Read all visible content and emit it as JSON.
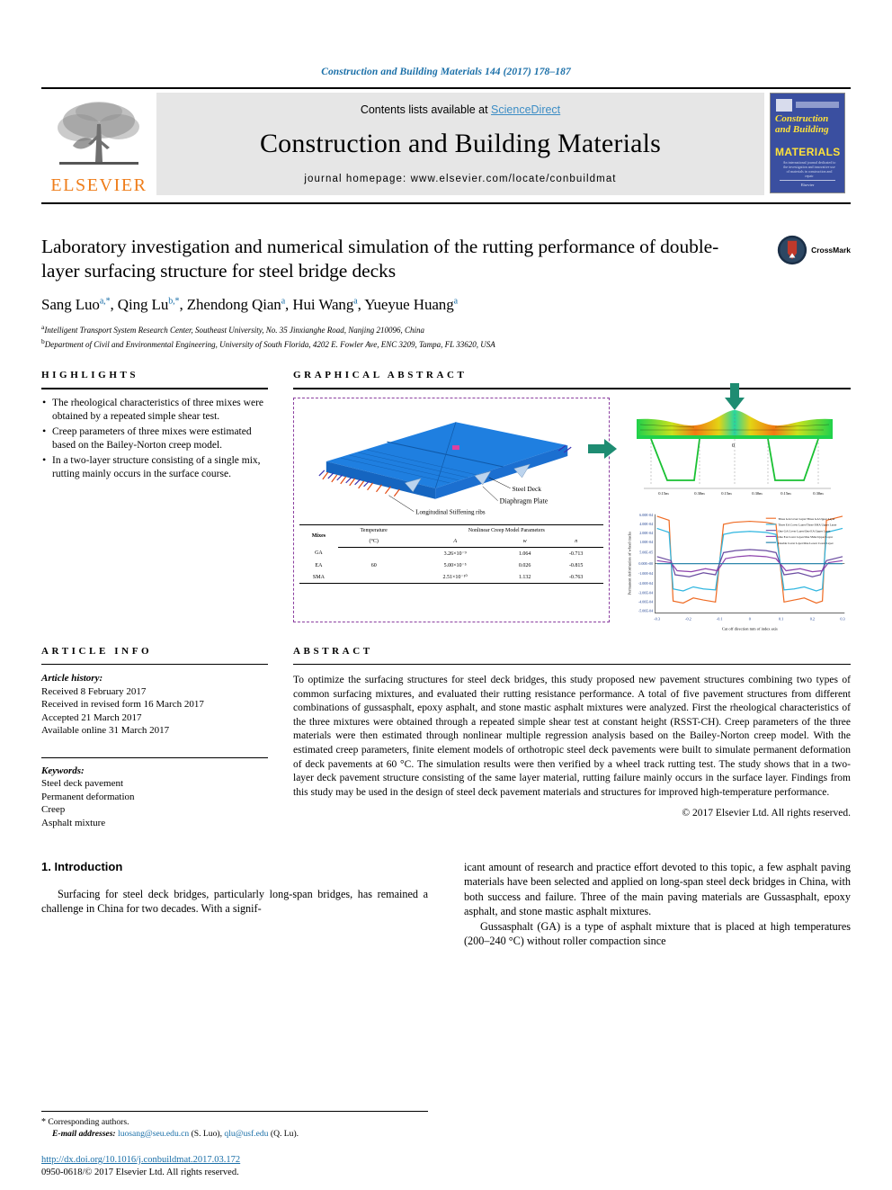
{
  "running_head": "Construction and Building Materials 144 (2017) 178–187",
  "banner": {
    "publisher_logo_text": "ELSEVIER",
    "contents_prefix": "Contents lists available at ",
    "contents_link": "ScienceDirect",
    "journal_name": "Construction and Building Materials",
    "homepage": "journal homepage: www.elsevier.com/locate/conbuildmat",
    "cover": {
      "title_line1": "Construction",
      "title_line2": "and Building",
      "materials": "MATERIALS",
      "subtitle": "An international journal dedicated to the investigation and innovative use of materials in construction and repair",
      "footer": "Elsevier"
    }
  },
  "article": {
    "title": "Laboratory investigation and numerical simulation of the rutting performance of double-layer surfacing structure for steel bridge decks",
    "crossmark_label": "CrossMark",
    "authors": [
      {
        "name": "Sang Luo",
        "sup": "a,*"
      },
      {
        "name": "Qing Lu",
        "sup": "b,*"
      },
      {
        "name": "Zhendong Qian",
        "sup": "a"
      },
      {
        "name": "Hui Wang",
        "sup": "a"
      },
      {
        "name": "Yueyue Huang",
        "sup": "a"
      }
    ],
    "affiliations": [
      {
        "mark": "a",
        "text": "Intelligent Transport System Research Center, Southeast University, No. 35 Jinxianghe Road, Nanjing 210096, China"
      },
      {
        "mark": "b",
        "text": "Department of Civil and Environmental Engineering, University of South Florida, 4202 E. Fowler Ave, ENC 3209, Tampa, FL 33620, USA"
      }
    ]
  },
  "highlights": {
    "heading": "HIGHLIGHTS",
    "items": [
      "The rheological characteristics of three mixes were obtained by a repeated simple shear test.",
      "Creep parameters of three mixes were estimated based on the Bailey-Norton creep model.",
      "In a two-layer structure consisting of a single mix, rutting mainly occurs in the surface course."
    ]
  },
  "graphical_abstract": {
    "heading": "GRAPHICAL ABSTRACT",
    "model_labels": {
      "steel_deck": "Steel Deck",
      "diaphragm_plate": "Diaphragm Plate",
      "stiffening_ribs": "Longitudinal Stiffening ribs"
    },
    "table": {
      "col_mixes": "Mixes",
      "col_temperature": "Temperature",
      "col_temperature_unit": "(°C)",
      "col_group": "Nonlinear Creep Model Parameters",
      "sub_cols": [
        "A",
        "w",
        "n"
      ],
      "rows": [
        {
          "mix": "GA",
          "temp": "",
          "A": "3.26×10⁻⁹",
          "w": "1.064",
          "n": "-0.713"
        },
        {
          "mix": "EA",
          "temp": "60",
          "A": "5.00×10⁻⁵",
          "w": "0.026",
          "n": "-0.815"
        },
        {
          "mix": "SMA",
          "temp": "",
          "A": "2.51×10⁻¹⁰",
          "w": "1.132",
          "n": "-0.763"
        }
      ]
    },
    "deformation_plot": {
      "x_ticks": [
        "0.15m",
        "0.30m",
        "0.15m",
        "0.30m",
        "0.15m",
        "0.30m"
      ],
      "center_label": "0"
    },
    "chart_data": {
      "type": "line",
      "title": "",
      "xlabel": "Cut off direction mm of index axis",
      "ylabel": "Permanent deformation  of wheel tracks",
      "x": [
        -0.3,
        -0.2,
        -0.1,
        0.0,
        0.1,
        0.2,
        0.3
      ],
      "x_ticks": [
        "-0.3",
        "-0.2",
        "-0.1",
        "0",
        "0.1",
        "0.2",
        "0.3"
      ],
      "y_ticks": [
        "6.00E-04",
        "4.00E-04",
        "2.00E-04",
        "1.00E-04",
        "5.00E-05",
        "0.00E+00",
        "-1.00E-04",
        "-2.00E-04",
        "-3.00E-04",
        "-4.00E-04",
        "-5.00E-04"
      ],
      "ylim": [
        -0.0005,
        0.0006
      ],
      "legend_position": "top-right",
      "series": [
        {
          "name": "Three GA Cover Layer/Three GA Upper Layer",
          "color": "#ef6c25",
          "values": [
            0.00055,
            -0.00042,
            -0.00038,
            0.00048,
            -0.00038,
            -0.00042,
            0.00055
          ]
        },
        {
          "name": "Three EA Cover Layer/Three SMA Upper Layer",
          "color": "#2fb6e0",
          "values": [
            0.0003,
            -0.00024,
            -0.00021,
            0.0003,
            -0.00021,
            -0.00024,
            0.0003
          ]
        },
        {
          "name": "One GA Cover Layer/One EA Upper Layer",
          "color": "#6a4ca0",
          "values": [
            8e-05,
            -9e-05,
            -7e-05,
            0.00012,
            -7e-05,
            -9e-05,
            8e-05
          ]
        },
        {
          "name": "One EA Cover Layer/One SMA Upper Layer",
          "color": "#8e44ad",
          "values": [
            5e-05,
            -6e-05,
            -5e-05,
            9e-05,
            -5e-05,
            -6e-05,
            5e-05
          ]
        },
        {
          "name": "Double Cover Layer/One Lower Cover Layer",
          "color": "#1a7fa8",
          "values": [
            0.0,
            0.0,
            0.0,
            0.0,
            0.0,
            0.0,
            0.0
          ]
        }
      ]
    }
  },
  "article_info": {
    "heading": "ARTICLE INFO",
    "history_label": "Article history:",
    "history": [
      "Received 8 February 2017",
      "Received in revised form 16 March 2017",
      "Accepted 21 March 2017",
      "Available online 31 March 2017"
    ],
    "keywords_label": "Keywords:",
    "keywords": [
      "Steel deck pavement",
      "Permanent deformation",
      "Creep",
      "Asphalt mixture"
    ]
  },
  "abstract": {
    "heading": "ABSTRACT",
    "text": "To optimize the surfacing structures for steel deck bridges, this study proposed new pavement structures combining two types of common surfacing mixtures, and evaluated their rutting resistance performance. A total of five pavement structures from different combinations of gussasphalt, epoxy asphalt, and stone mastic asphalt mixtures were analyzed. First the rheological characteristics of the three mixtures were obtained through a repeated simple shear test at constant height (RSST-CH). Creep parameters of the three materials were then estimated through nonlinear multiple regression analysis based on the Bailey-Norton creep model. With the estimated creep parameters, finite element models of orthotropic steel deck pavements were built to simulate permanent deformation of deck pavements at 60 °C. The simulation results were then verified by a wheel track rutting test. The study shows that in a two-layer deck pavement structure consisting of the same layer material, rutting failure mainly occurs in the surface layer. Findings from this study may be used in the design of steel deck pavement materials and structures for improved high-temperature performance.",
    "copyright": "© 2017 Elsevier Ltd. All rights reserved."
  },
  "body": {
    "section_title": "1. Introduction",
    "col1_para1": "Surfacing for steel deck bridges, particularly long-span bridges, has remained a challenge in China for two decades. With a signif-",
    "col2_para1": "icant amount of research and practice effort devoted to this topic, a few asphalt paving materials have been selected and applied on long-span steel deck bridges in China, with both success and failure. Three of the main paving materials are Gussasphalt, epoxy asphalt, and stone mastic asphalt mixtures.",
    "col2_para2": "Gussasphalt (GA) is a type of asphalt mixture that is placed at high temperatures (200–240 °C) without roller compaction since"
  },
  "footnote": {
    "corresponding": "Corresponding authors.",
    "email_label": "E-mail addresses:",
    "email1": "luosang@seu.edu.cn",
    "email1_owner": "(S. Luo),",
    "email2": "qlu@usf.edu",
    "email2_owner": "(Q. Lu).",
    "doi": "http://dx.doi.org/10.1016/j.conbuildmat.2017.03.172",
    "issn": "0950-0618/© 2017 Elsevier Ltd. All rights reserved."
  },
  "colors": {
    "link": "#1a6fa8",
    "elsevier_orange": "#ef7d1a",
    "banner_gray": "#e6e6e6",
    "ga_border": "#8b3fa0"
  }
}
